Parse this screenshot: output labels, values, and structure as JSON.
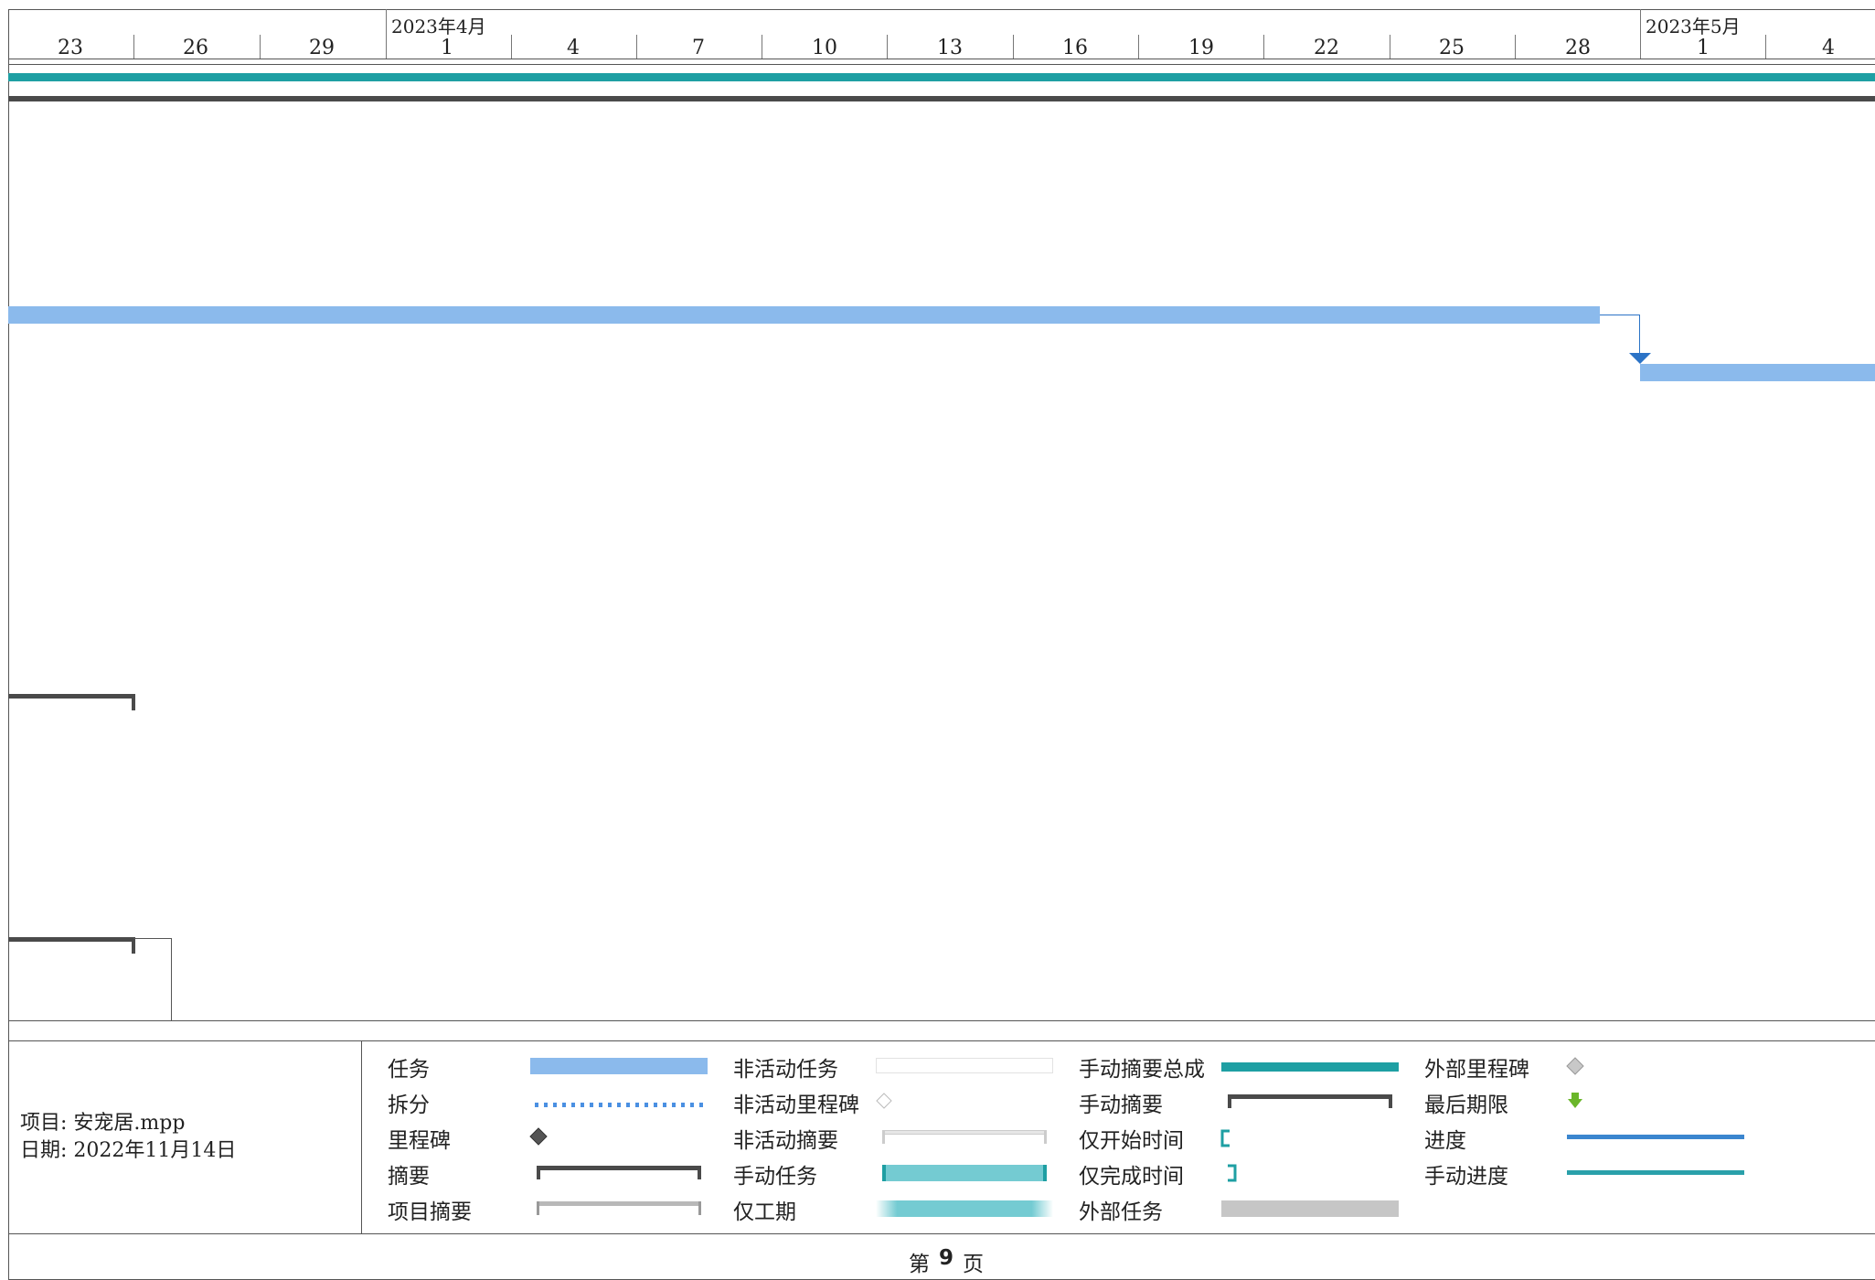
{
  "timescale": {
    "months": [
      "2023年4月",
      "2023年5月"
    ],
    "days": [
      "23",
      "26",
      "29",
      "1",
      "4",
      "7",
      "10",
      "13",
      "16",
      "19",
      "22",
      "25",
      "28",
      "1",
      "4"
    ]
  },
  "colors": {
    "task": "#8bbaec",
    "manual_summary_rollup": "#1e9fa3",
    "summary": "#4a4a4a",
    "link": "#2b73c6",
    "progress": "#3b86cf",
    "manual_progress": "#2aa0aa",
    "deadline": "#6ab62a",
    "external_task": "#c6c6c6",
    "manual_task": "#74cbd2"
  },
  "project_info": {
    "project_line": "项目: 安宠居.mpp",
    "date_line": "日期: 2022年11月14日"
  },
  "legend": {
    "col1": [
      "任务",
      "拆分",
      "里程碑",
      "摘要",
      "项目摘要"
    ],
    "col2": [
      "非活动任务",
      "非活动里程碑",
      "非活动摘要",
      "手动任务",
      "仅工期"
    ],
    "col3": [
      "手动摘要总成",
      "手动摘要",
      "仅开始时间",
      "仅完成时间",
      "外部任务"
    ],
    "col4": [
      "外部里程碑",
      "最后期限",
      "进度",
      "手动进度"
    ]
  },
  "footer": {
    "page_prefix": "第",
    "page_number": "9",
    "page_suffix": "页"
  }
}
